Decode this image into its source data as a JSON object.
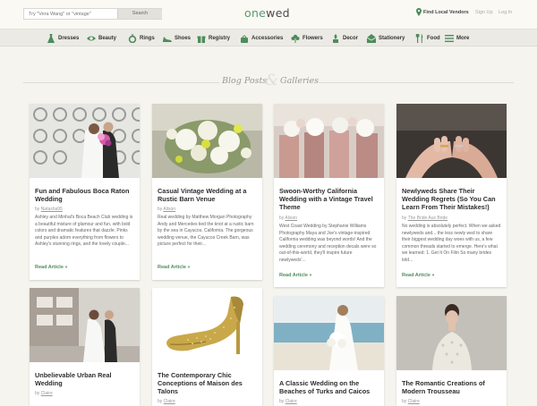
{
  "header": {
    "search_placeholder": "Try \"Vera Wang\" or \"vintage\"",
    "search_button": "Search",
    "logo_prefix": "one",
    "logo_suffix": "wed",
    "find_vendors": "Find Local Vendors",
    "signup": "Sign Up",
    "login": "Log In"
  },
  "nav": [
    {
      "label": "Dresses",
      "icon": "dress-icon"
    },
    {
      "label": "Beauty",
      "icon": "eye-icon"
    },
    {
      "label": "Rings",
      "icon": "ring-icon"
    },
    {
      "label": "Shoes",
      "icon": "shoe-icon"
    },
    {
      "label": "Registry",
      "icon": "gift-icon"
    },
    {
      "label": "Accessories",
      "icon": "bag-icon"
    },
    {
      "label": "Flowers",
      "icon": "flower-icon"
    },
    {
      "label": "Decor",
      "icon": "decor-icon"
    },
    {
      "label": "Stationery",
      "icon": "envelope-icon"
    },
    {
      "label": "Food",
      "icon": "utensils-icon"
    },
    {
      "label": "More",
      "icon": "list-icon"
    }
  ],
  "section": {
    "part1": "Blog Posts",
    "amp": "&",
    "part2": "Galleries"
  },
  "cards": [
    {
      "title": "Fun and Fabulous Boca Raton Wedding",
      "by": "by",
      "author": "Natasha95",
      "excerpt": "Ashley and Minhal's Boca Beach Club wedding is a beautiful mixture of glamour and fun, with bold colors and dramatic features that dazzle. Pinks and purples adorn everything from flowers to Ashley's stunning rings, and the lovely couple...",
      "readmore": "Read Article »"
    },
    {
      "title": "Casual Vintage Wedding at a Rustic Barn Venue",
      "by": "by",
      "author": "Alison",
      "excerpt": "  Real wedding by Matthew Morgan Photography    Andy and Mercedes tied the knot at a rustic barn by the sea in Cayucos, California.  The gorgeous wedding venue, the Cayucos Creek Barn, was picture perfect for their...",
      "readmore": "Read Article »"
    },
    {
      "title": "Swoon-Worthy California Wedding with a Vintage Travel Theme",
      "by": "by",
      "author": "Alison",
      "excerpt": "West Coast Wedding by Stephanie Williams Photography Maya and Joe's vintage-inspired California wedding was beyond words! And the wedding ceremony and reception decals were so out-of-this-world, they'll inspire future newlyweds'...",
      "readmore": "Read Article »"
    },
    {
      "title": "Newlyweds Share Their Wedding Regrets (So You Can Learn From Their Mistakes!)",
      "by": "by",
      "author": "The Bride Aux Bride",
      "excerpt": "No wedding is absolutely perfect. When we asked newlyweds and... the less newly wed to share their biggest wedding day woes with us, a few common threads started to emerge. Here's what we learned: 1. Get It On Film So many brides told...",
      "readmore": "Read Article »"
    },
    {
      "title": "Unbelievable Urban Real Wedding",
      "by": "by",
      "author": "Claire",
      "excerpt": "",
      "readmore": ""
    },
    {
      "title": "The Contemporary Chic Conceptions of Maison des Talons",
      "by": "by",
      "author": "Claire",
      "excerpt": "",
      "readmore": ""
    },
    {
      "title": "A Classic Wedding on the Beaches of Turks and Caicos",
      "by": "by",
      "author": "Claire",
      "excerpt": "",
      "readmore": ""
    },
    {
      "title": "The Romantic Creations of Modern Trousseau",
      "by": "by",
      "author": "Claire",
      "excerpt": "",
      "readmore": ""
    }
  ],
  "colors": {
    "accent_green": "#4d8c5c",
    "logo_green": "#5a9a6e",
    "background": "#f5f4ee"
  }
}
